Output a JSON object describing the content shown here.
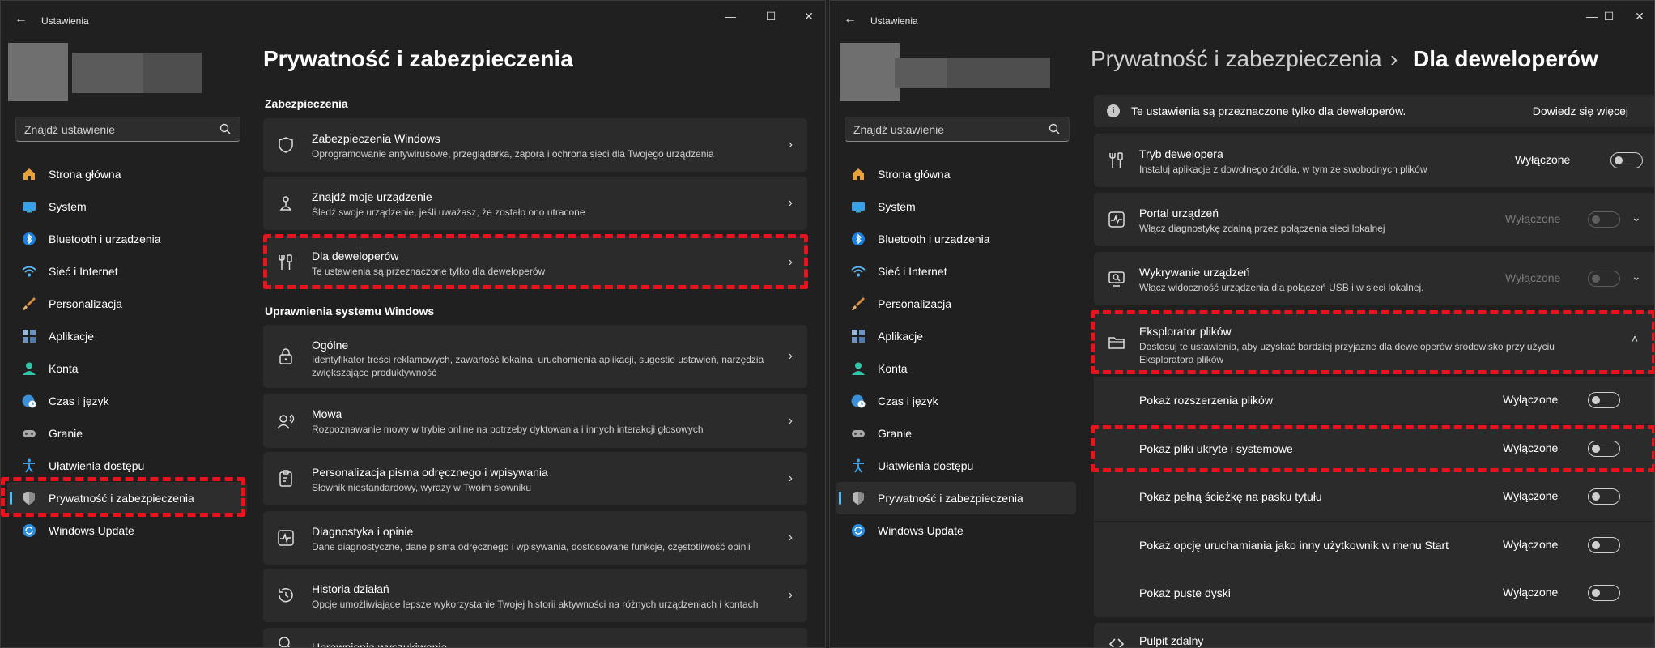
{
  "app_title": "Ustawienia",
  "search_placeholder": "Znajdź ustawienie",
  "nav": [
    {
      "label": "Strona główna",
      "icon": "home-icon"
    },
    {
      "label": "System",
      "icon": "system-icon"
    },
    {
      "label": "Bluetooth i urządzenia",
      "icon": "bluetooth-icon"
    },
    {
      "label": "Sieć i Internet",
      "icon": "wifi-icon"
    },
    {
      "label": "Personalizacja",
      "icon": "brush-icon"
    },
    {
      "label": "Aplikacje",
      "icon": "apps-icon"
    },
    {
      "label": "Konta",
      "icon": "account-icon"
    },
    {
      "label": "Czas i język",
      "icon": "globe-clock-icon"
    },
    {
      "label": "Granie",
      "icon": "gamepad-icon"
    },
    {
      "label": "Ułatwienia dostępu",
      "icon": "accessibility-icon"
    },
    {
      "label": "Prywatność i zabezpieczenia",
      "icon": "shield-icon"
    },
    {
      "label": "Windows Update",
      "icon": "update-icon"
    }
  ],
  "left": {
    "title": "Prywatność i zabezpieczenia",
    "section1": "Zabezpieczenia",
    "section2": "Uprawnienia systemu Windows",
    "cards": [
      {
        "title": "Zabezpieczenia Windows",
        "desc": "Oprogramowanie antywirusowe, przeglądarka, zapora i ochrona sieci dla Twojego urządzenia",
        "icon": "shield-outline-icon"
      },
      {
        "title": "Znajdź moje urządzenie",
        "desc": "Śledź swoje urządzenie, jeśli uważasz, że zostało ono utracone",
        "icon": "person-location-icon"
      },
      {
        "title": "Dla deweloperów",
        "desc": "Te ustawienia są przeznaczone tylko dla deweloperów",
        "icon": "developer-tools-icon"
      },
      {
        "title": "Ogólne",
        "desc": "Identyfikator treści reklamowych, zawartość lokalna, uruchomienia aplikacji, sugestie ustawień, narzędzia zwiększające produktywność",
        "icon": "lock-icon"
      },
      {
        "title": "Mowa",
        "desc": "Rozpoznawanie mowy w trybie online na potrzeby dyktowania i innych interakcji głosowych",
        "icon": "speech-icon"
      },
      {
        "title": "Personalizacja pisma odręcznego i wpisywania",
        "desc": "Słownik niestandardowy, wyrazy w Twoim słowniku",
        "icon": "clipboard-pen-icon"
      },
      {
        "title": "Diagnostyka i opinie",
        "desc": "Dane diagnostyczne, dane pisma odręcznego i wpisywania, dostosowane funkcje, częstotliwość opinii",
        "icon": "diagnostics-icon"
      },
      {
        "title": "Historia działań",
        "desc": "Opcje umożliwiające lepsze wykorzystanie Twojej historii aktywności na różnych urządzeniach i kontach",
        "icon": "history-icon"
      },
      {
        "title": "Uprawnienia wyszukiwania",
        "desc": "",
        "icon": "search-icon"
      }
    ]
  },
  "right": {
    "breadcrumb_parent": "Prywatność i zabezpieczenia",
    "breadcrumb_sep": "›",
    "breadcrumb_current": "Dla deweloperów",
    "info_text": "Te ustawienia są przeznaczone tylko dla deweloperów.",
    "info_link": "Dowiedz się więcej",
    "rows": [
      {
        "title": "Tryb dewelopera",
        "desc": "Instaluj aplikacje z dowolnego źródła, w tym ze swobodnych plików",
        "state": "Wyłączone",
        "icon": "developer-tools-icon"
      },
      {
        "title": "Portal urządzeń",
        "desc": "Włącz diagnostykę zdalną przez połączenia sieci lokalnej",
        "state": "Wyłączone",
        "icon": "pulse-icon"
      },
      {
        "title": "Wykrywanie urządzeń",
        "desc": "Włącz widoczność urządzenia dla połączeń USB i w sieci lokalnej.",
        "state": "Wyłączone",
        "icon": "device-search-icon"
      },
      {
        "title": "Eksplorator plików",
        "desc": "Dostosuj te ustawienia, aby uzyskać bardziej przyjazne dla deweloperów środowisko przy użyciu Eksploratora plików",
        "icon": "folder-icon"
      }
    ],
    "sub_rows": [
      {
        "title": "Pokaż rozszerzenia plików",
        "state": "Wyłączone"
      },
      {
        "title": "Pokaż pliki ukryte i systemowe",
        "state": "Wyłączone"
      },
      {
        "title": "Pokaż pełną ścieżkę na pasku tytułu",
        "state": "Wyłączone"
      },
      {
        "title": "Pokaż opcję uruchamiania jako inny użytkownik w menu Start",
        "state": "Wyłączone"
      },
      {
        "title": "Pokaż puste dyski",
        "state": "Wyłączone"
      }
    ],
    "last_row": {
      "title": "Pulpit zdalny",
      "icon": "remote-desktop-icon"
    }
  }
}
